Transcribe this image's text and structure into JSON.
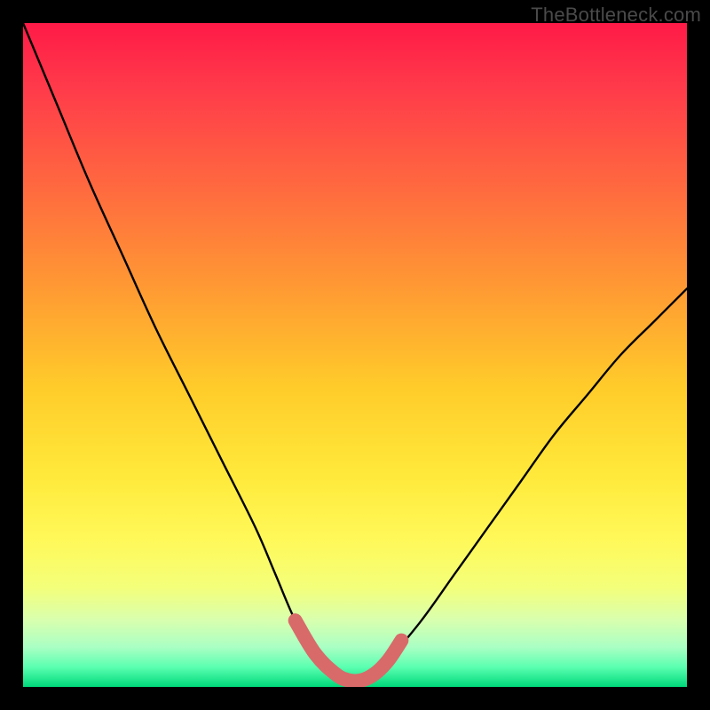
{
  "watermark": "TheBottleneck.com",
  "chart_data": {
    "type": "line",
    "title": "",
    "xlabel": "",
    "ylabel": "",
    "xlim": [
      0,
      100
    ],
    "ylim": [
      0,
      100
    ],
    "grid": false,
    "legend": false,
    "annotations": [],
    "series": [
      {
        "name": "bottleneck-curve",
        "color": "#000000",
        "x": [
          0,
          5,
          10,
          15,
          20,
          25,
          30,
          35,
          38,
          41,
          44,
          47,
          49,
          51,
          53,
          55,
          60,
          65,
          70,
          75,
          80,
          85,
          90,
          95,
          100
        ],
        "y": [
          100,
          88,
          76,
          65,
          54,
          44,
          34,
          24,
          17,
          10,
          5,
          2,
          1,
          1,
          2,
          4,
          10,
          17,
          24,
          31,
          38,
          44,
          50,
          55,
          60
        ]
      },
      {
        "name": "optimal-range-highlight",
        "color": "#d86a6a",
        "x": [
          41,
          44,
          47,
          49,
          51,
          53,
          55,
          57
        ],
        "y": [
          10,
          5,
          2,
          1,
          1,
          2,
          4,
          7
        ]
      }
    ]
  }
}
